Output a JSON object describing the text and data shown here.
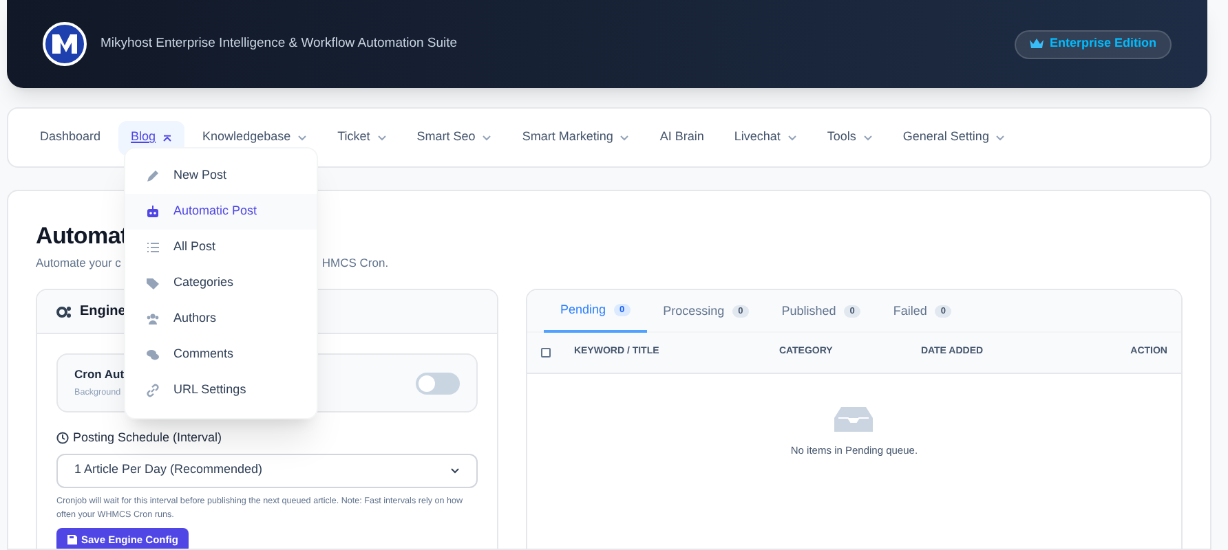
{
  "header": {
    "title": "Mikyhost Enterprise Intelligence & Workflow Automation Suite",
    "badge": "Enterprise Edition"
  },
  "nav": [
    {
      "label": "Dashboard",
      "selected": false,
      "kind": "link"
    },
    {
      "label": "Blog",
      "selected": true,
      "kind": "menu",
      "expanded": true
    },
    {
      "label": "Knowledgebase",
      "selected": false,
      "kind": "menu",
      "expanded": false
    },
    {
      "label": "Ticket",
      "selected": false,
      "kind": "menu",
      "expanded": false
    },
    {
      "label": "Smart Seo",
      "selected": false,
      "kind": "menu",
      "expanded": false
    },
    {
      "label": "Smart Marketing",
      "selected": false,
      "kind": "menu",
      "expanded": false
    },
    {
      "label": "AI Brain",
      "selected": false,
      "kind": "link"
    },
    {
      "label": "Livechat",
      "selected": false,
      "kind": "menu",
      "expanded": false
    },
    {
      "label": "Tools",
      "selected": false,
      "kind": "menu",
      "expanded": false
    },
    {
      "label": "General Setting",
      "selected": false,
      "kind": "menu",
      "expanded": false
    }
  ],
  "blog_menu": [
    {
      "label": "New Post",
      "selected": false
    },
    {
      "label": "Automatic Post",
      "selected": true
    },
    {
      "label": "All Post",
      "selected": false
    },
    {
      "label": "Categories",
      "selected": false
    },
    {
      "label": "Authors",
      "selected": false
    },
    {
      "label": "Comments",
      "selected": false
    },
    {
      "label": "URL Settings",
      "selected": false
    }
  ],
  "page": {
    "title": "Automat",
    "subtitle_start": "Automate your c",
    "subtitle_end": "HMCS Cron."
  },
  "engine": {
    "title": "Engine",
    "cron": {
      "label": "Cron Aut",
      "hint": "Background",
      "on": false
    },
    "schedule_label": "Posting Schedule (Interval)",
    "schedule_value": "1 Article Per Day (Recommended)",
    "help": "Cronjob will wait for this interval before publishing the next queued article. Note: Fast intervals rely on how often your WHMCS Cron runs.",
    "save": "Save Engine Config"
  },
  "queue": {
    "tabs": [
      {
        "label": "Pending",
        "count": "0",
        "selected": true
      },
      {
        "label": "Processing",
        "count": "0",
        "selected": false
      },
      {
        "label": "Published",
        "count": "0",
        "selected": false
      },
      {
        "label": "Failed",
        "count": "0",
        "selected": false
      }
    ],
    "select_all_checked": false,
    "columns": [
      "KEYWORD / TITLE",
      "CATEGORY",
      "DATE ADDED",
      "ACTION"
    ],
    "empty": "No items in Pending queue."
  }
}
